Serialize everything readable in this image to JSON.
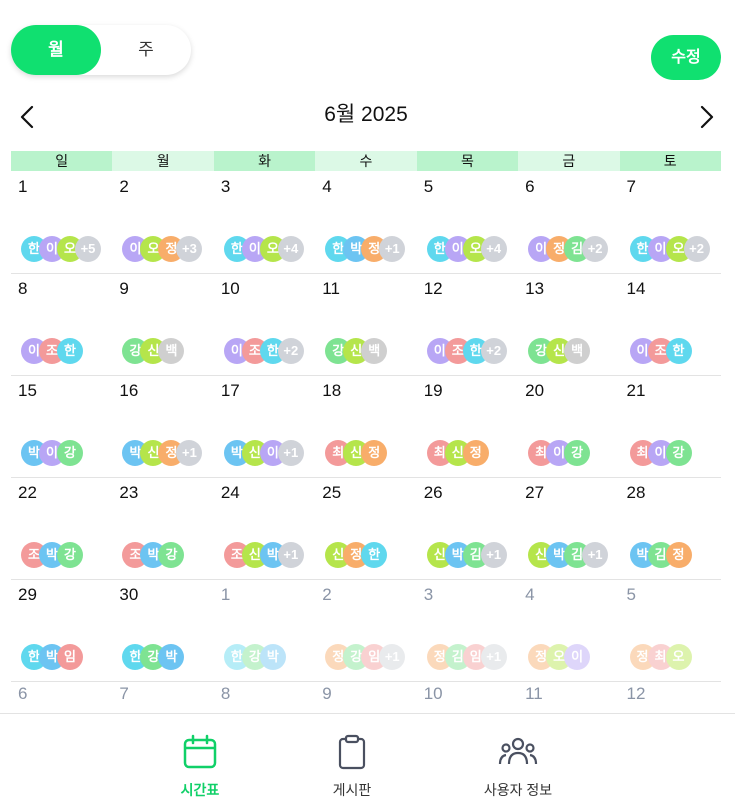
{
  "view_toggle": {
    "month": "월",
    "week": "주"
  },
  "edit_label": "수정",
  "month_title": "6월 2025",
  "weekdays": [
    "일",
    "월",
    "화",
    "수",
    "목",
    "금",
    "토"
  ],
  "colors": {
    "accent": "#10e070",
    "header_dark": "#b9f3cc",
    "header_light": "#dcf9e6"
  },
  "avatar_colors": {
    "한": "#5fd8ee",
    "이": "#b8a6f5",
    "오": "#b5e54b",
    "정": "#f8ad6a",
    "박": "#6cc4f2",
    "조": "#f39a9a",
    "강": "#7ee392",
    "신": "#b5e54b",
    "백": "#cfcfcf",
    "김": "#7ee392",
    "최": "#f39a9a",
    "임": "#f39a9a",
    "more": "#d0d3d9"
  },
  "weeks": [
    [
      {
        "day": "1",
        "av": [
          "한",
          "이",
          "오"
        ],
        "more": "+5"
      },
      {
        "day": "2",
        "av": [
          "이",
          "오",
          "정"
        ],
        "more": "+3"
      },
      {
        "day": "3",
        "av": [
          "한",
          "이",
          "오"
        ],
        "more": "+4"
      },
      {
        "day": "4",
        "av": [
          "한",
          "박",
          "정"
        ],
        "more": "+1"
      },
      {
        "day": "5",
        "av": [
          "한",
          "이",
          "오"
        ],
        "more": "+4"
      },
      {
        "day": "6",
        "av": [
          "이",
          "정",
          "김"
        ],
        "more": "+2"
      },
      {
        "day": "7",
        "av": [
          "한",
          "이",
          "오"
        ],
        "more": "+2"
      }
    ],
    [
      {
        "day": "8",
        "av": [
          "이",
          "조",
          "한"
        ],
        "more": ""
      },
      {
        "day": "9",
        "av": [
          "강",
          "신",
          "백"
        ],
        "more": ""
      },
      {
        "day": "10",
        "av": [
          "이",
          "조",
          "한"
        ],
        "more": "+2"
      },
      {
        "day": "11",
        "av": [
          "강",
          "신",
          "백"
        ],
        "more": ""
      },
      {
        "day": "12",
        "av": [
          "이",
          "조",
          "한"
        ],
        "more": "+2"
      },
      {
        "day": "13",
        "av": [
          "강",
          "신",
          "백"
        ],
        "more": ""
      },
      {
        "day": "14",
        "av": [
          "이",
          "조",
          "한"
        ],
        "more": ""
      }
    ],
    [
      {
        "day": "15",
        "av": [
          "박",
          "이",
          "강"
        ],
        "more": ""
      },
      {
        "day": "16",
        "av": [
          "박",
          "신",
          "정"
        ],
        "more": "+1"
      },
      {
        "day": "17",
        "av": [
          "박",
          "신",
          "이"
        ],
        "more": "+1"
      },
      {
        "day": "18",
        "av": [
          "최",
          "신",
          "정"
        ],
        "more": ""
      },
      {
        "day": "19",
        "av": [
          "최",
          "신",
          "정"
        ],
        "more": ""
      },
      {
        "day": "20",
        "av": [
          "최",
          "이",
          "강"
        ],
        "more": ""
      },
      {
        "day": "21",
        "av": [
          "최",
          "이",
          "강"
        ],
        "more": ""
      }
    ],
    [
      {
        "day": "22",
        "av": [
          "조",
          "박",
          "강"
        ],
        "more": ""
      },
      {
        "day": "23",
        "av": [
          "조",
          "박",
          "강"
        ],
        "more": ""
      },
      {
        "day": "24",
        "av": [
          "조",
          "신",
          "박"
        ],
        "more": "+1"
      },
      {
        "day": "25",
        "av": [
          "신",
          "정",
          "한"
        ],
        "more": ""
      },
      {
        "day": "26",
        "av": [
          "신",
          "박",
          "김"
        ],
        "more": "+1"
      },
      {
        "day": "27",
        "av": [
          "신",
          "박",
          "김"
        ],
        "more": "+1"
      },
      {
        "day": "28",
        "av": [
          "박",
          "김",
          "정"
        ],
        "more": ""
      }
    ],
    [
      {
        "day": "29",
        "av": [
          "한",
          "박",
          "임"
        ],
        "more": ""
      },
      {
        "day": "30",
        "av": [
          "한",
          "강",
          "박"
        ],
        "more": ""
      },
      {
        "day": "1",
        "av": [
          "한",
          "강",
          "박"
        ],
        "more": "",
        "other": true
      },
      {
        "day": "2",
        "av": [
          "정",
          "강",
          "임"
        ],
        "more": "+1",
        "other": true
      },
      {
        "day": "3",
        "av": [
          "정",
          "김",
          "임"
        ],
        "more": "+1",
        "other": true
      },
      {
        "day": "4",
        "av": [
          "정",
          "오",
          "이"
        ],
        "more": "",
        "other": true
      },
      {
        "day": "5",
        "av": [
          "정",
          "최",
          "오"
        ],
        "more": "",
        "other": true
      }
    ]
  ],
  "last_row_days": [
    "6",
    "7",
    "8",
    "9",
    "10",
    "11",
    "12"
  ],
  "tabs": [
    {
      "label": "시간표",
      "icon": "calendar-icon"
    },
    {
      "label": "게시판",
      "icon": "clipboard-icon"
    },
    {
      "label": "사용자 정보",
      "icon": "users-icon"
    }
  ]
}
